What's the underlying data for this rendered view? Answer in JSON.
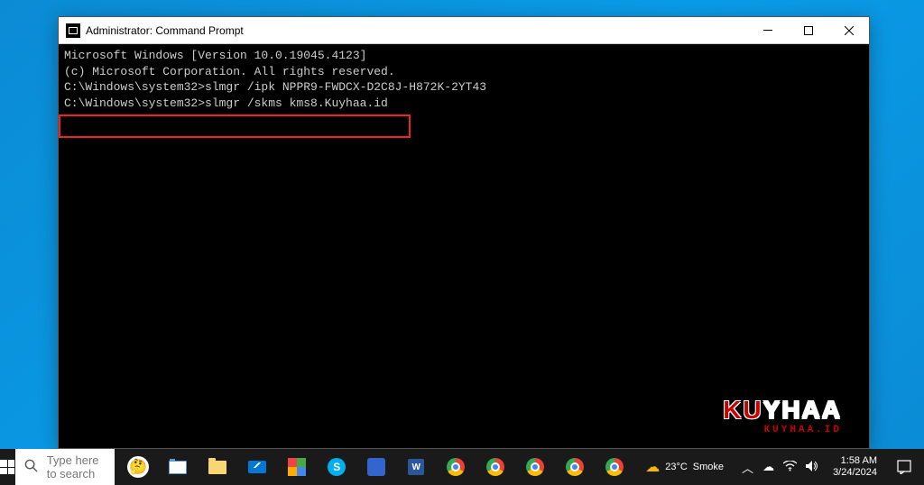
{
  "window": {
    "title": "Administrator: Command Prompt"
  },
  "cmd": {
    "line1": "Microsoft Windows [Version 10.0.19045.4123]",
    "line2": "(c) Microsoft Corporation. All rights reserved.",
    "blank1": "",
    "line3": "C:\\Windows\\system32>slmgr /ipk NPPR9-FWDCX-D2C8J-H872K-2YT43",
    "blank2": "",
    "line4": "C:\\Windows\\system32>slmgr /skms kms8.Kuyhaa.id"
  },
  "watermark": {
    "main_left": "KU",
    "main_right": "YHAA",
    "sub": "KUYHAA.ID"
  },
  "taskbar": {
    "search_placeholder": "Type here to search",
    "weather_temp": "23°C",
    "weather_cond": "Smoke",
    "time": "1:58 AM",
    "date": "3/24/2024"
  }
}
